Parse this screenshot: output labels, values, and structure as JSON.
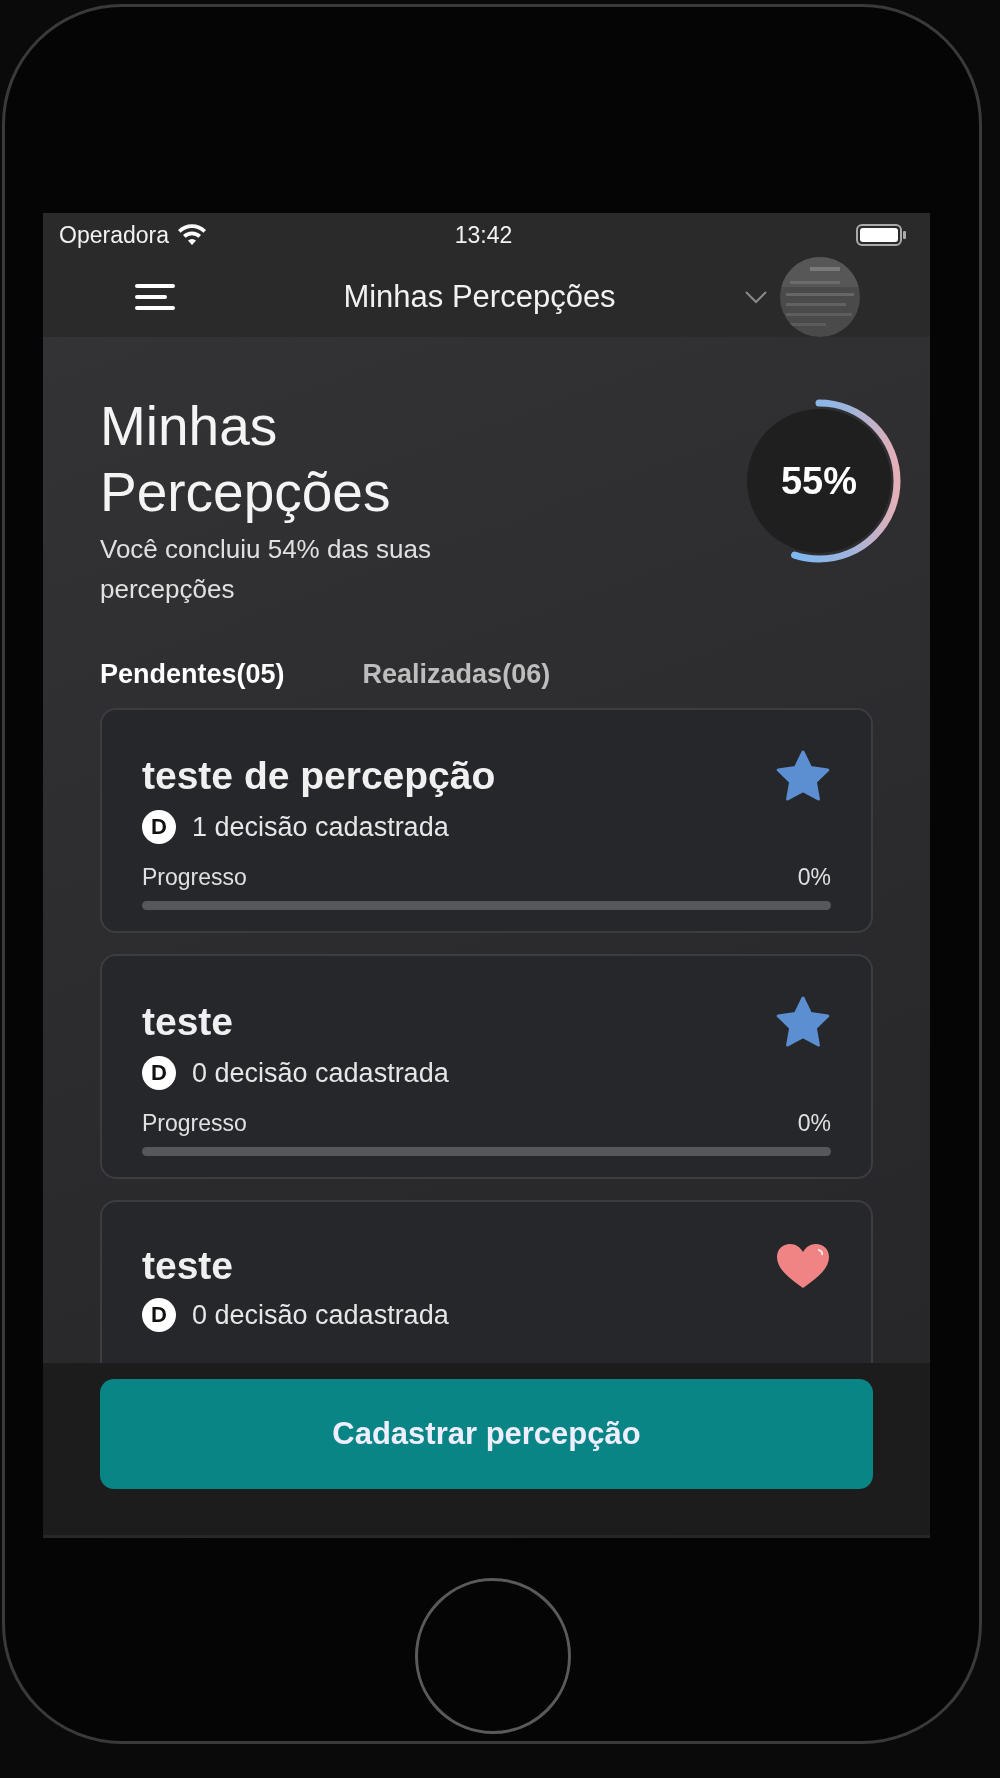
{
  "status_bar": {
    "carrier": "Operadora",
    "time": "13:42"
  },
  "header": {
    "title": "Minhas Percepções"
  },
  "hero": {
    "title": "Minhas Percepções",
    "subtitle": "Você concluiu 54% das suas percepções",
    "ring": {
      "level": 0.55,
      "reading": "55%"
    }
  },
  "tabs": [
    {
      "label": "Pendentes(05)",
      "selected": true
    },
    {
      "label": "Realizadas(06)",
      "selected": false
    }
  ],
  "cards": [
    {
      "title": "teste de percepção",
      "badge": "D",
      "decisions": "1 decisão cadastrada",
      "kind": "star",
      "progress": {
        "label": "Progresso",
        "reading": "0%",
        "level": 0
      }
    },
    {
      "title": "teste",
      "badge": "D",
      "decisions": "0 decisão cadastrada",
      "kind": "star",
      "progress": {
        "label": "Progresso",
        "reading": "0%",
        "level": 0
      }
    },
    {
      "title": "teste",
      "badge": "D",
      "decisions": "0 decisão cadastrada",
      "kind": "heart"
    }
  ],
  "button": "Cadastrar percepção"
}
